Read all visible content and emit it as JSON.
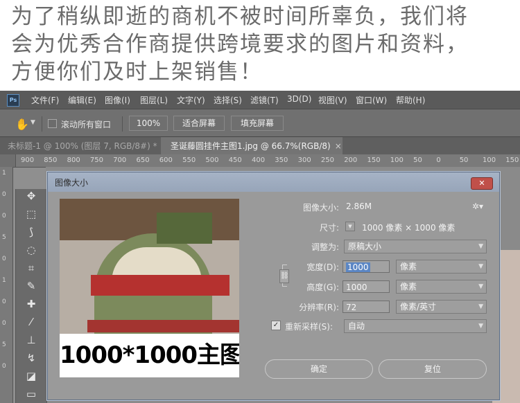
{
  "banner": {
    "lines": [
      "为了稍纵即逝的商机不被时间所辜负，我们将",
      "会为优秀合作商提供跨境要求的图片和资料，",
      "方便你们及时上架销售！"
    ]
  },
  "app": {
    "logo": "Ps",
    "menu": [
      "文件(F)",
      "编辑(E)",
      "图像(I)",
      "图层(L)",
      "文字(Y)",
      "选择(S)",
      "滤镜(T)",
      "3D(D)",
      "视图(V)",
      "窗口(W)",
      "帮助(H)"
    ]
  },
  "options": {
    "scroll_all_label": "滚动所有窗口",
    "zoom_value": "100%",
    "fit_screen": "适合屏幕",
    "fill_screen": "填充屏幕"
  },
  "tabs": [
    {
      "label": "未标题-1 @ 100% (图层 7, RGB/8#) *"
    },
    {
      "label": "圣诞藤圆挂件主图1.jpg @ 66.7%(RGB/8)"
    }
  ],
  "tab_close": "×",
  "ruler": {
    "h_ticks": [
      "900",
      "850",
      "800",
      "750",
      "700",
      "650",
      "600",
      "550",
      "500",
      "450",
      "400",
      "350",
      "300",
      "250",
      "200",
      "150",
      "100",
      "50",
      "0",
      "50",
      "100",
      "150"
    ],
    "v_ticks": [
      "1",
      "0",
      "0",
      "5",
      "0",
      "1",
      "0",
      "0",
      "5",
      "0"
    ]
  },
  "dialog": {
    "title": "图像大小",
    "close": "✕",
    "image_size_label": "图像大小:",
    "image_size_value": "2.86M",
    "dimensions_label": "尺寸:",
    "dimensions_value": "1000 像素 × 1000 像素",
    "fit_to_label": "调整为:",
    "fit_to_value": "原稿大小",
    "width_label": "宽度(D):",
    "width_value": "1000",
    "width_unit": "像素",
    "height_label": "高度(G):",
    "height_value": "1000",
    "height_unit": "像素",
    "resolution_label": "分辨率(R):",
    "resolution_value": "72",
    "resolution_unit": "像素/英寸",
    "resample_label": "重新采样(S):",
    "resample_value": "自动",
    "ok_button": "确定",
    "reset_button": "复位",
    "preview_caption": "1000*1000主图"
  }
}
